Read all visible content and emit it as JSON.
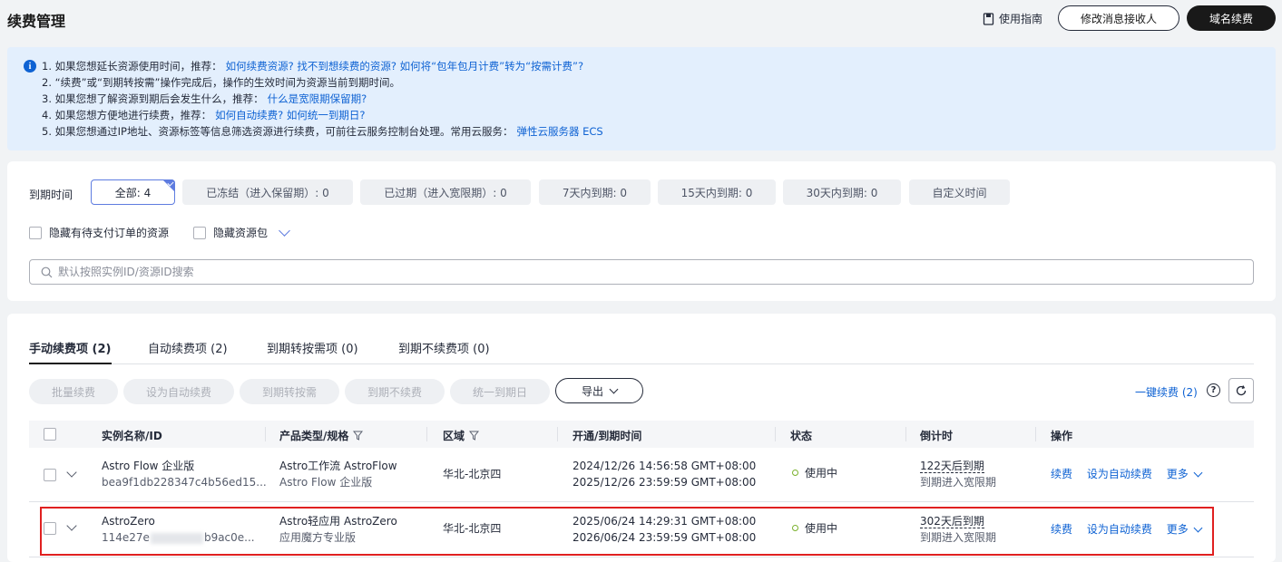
{
  "header": {
    "title": "续费管理",
    "guide_label": "使用指南",
    "modify_receiver_label": "修改消息接收人",
    "domain_renew_label": "域名续费"
  },
  "notice": {
    "lines": [
      {
        "text": "1. 如果您想延长资源使用时间，推荐：",
        "link": "如何续费资源? 找不到想续费的资源? 如何将“包年包月计费”转为“按需计费”?"
      },
      {
        "text": "2. “续费”或“到期转按需”操作完成后，操作的生效时间为资源当前到期时间。",
        "link": ""
      },
      {
        "text": "3. 如果您想了解资源到期后会发生什么，推荐：",
        "link": "什么是宽限期保留期?"
      },
      {
        "text": "4. 如果您想方便地进行续费，推荐：",
        "link": "如何自动续费? 如何统一到期日?"
      },
      {
        "text": "5. 如果您想通过IP地址、资源标签等信息筛选资源进行续费，可前往云服务控制台处理。常用云服务：",
        "link": "弹性云服务器 ECS"
      }
    ]
  },
  "filters": {
    "expire_label": "到期时间",
    "chips": [
      "全部: 4",
      "已冻结（进入保留期）: 0",
      "已过期（进入宽限期）: 0",
      "7天内到期: 0",
      "15天内到期: 0",
      "30天内到期: 0",
      "自定义时间"
    ],
    "hide_pending_label": "隐藏有待支付订单的资源",
    "hide_package_label": "隐藏资源包",
    "search_placeholder": "默认按照实例ID/资源ID搜索"
  },
  "tabs": [
    "手动续费项 (2)",
    "自动续费项 (2)",
    "到期转按需项 (0)",
    "到期不续费项 (0)"
  ],
  "toolbar": {
    "batch_renew": "批量续费",
    "set_auto": "设为自动续费",
    "to_ondemand": "到期转按需",
    "no_renew": "到期不续费",
    "unify_date": "统一到期日",
    "export": "导出",
    "renew_all": "一键续费",
    "renew_all_count": "(2)"
  },
  "table": {
    "columns": [
      "实例名称/ID",
      "产品类型/规格",
      "区域",
      "开通/到期时间",
      "状态",
      "倒计时",
      "操作"
    ],
    "rows": [
      {
        "name": "Astro Flow 企业版",
        "id": "bea9f1db228347c4b56ed15...",
        "product": "Astro工作流 AstroFlow",
        "spec": "Astro Flow 企业版",
        "region": "华北-北京四",
        "open_time": "2024/12/26 14:56:58 GMT+08:00",
        "expire_time": "2025/12/26 23:59:59 GMT+08:00",
        "status": "使用中",
        "countdown": "122天后到期",
        "countdown_sub": "到期进入宽限期",
        "actions": [
          "续费",
          "设为自动续费",
          "更多"
        ]
      },
      {
        "name": "AstroZero",
        "id_prefix": "114e27e",
        "id_suffix": "b9ac0e...",
        "product": "Astro轻应用 AstroZero",
        "spec": "应用魔方专业版",
        "region": "华北-北京四",
        "open_time": "2025/06/24 14:29:31 GMT+08:00",
        "expire_time": "2026/06/24 23:59:59 GMT+08:00",
        "status": "使用中",
        "countdown": "302天后到期",
        "countdown_sub": "到期进入宽限期",
        "actions": [
          "续费",
          "设为自动续费",
          "更多"
        ]
      }
    ]
  },
  "colors": {
    "link": "#0e62d3",
    "notice_bg": "#e3effd",
    "status_ok": "#7ab12d",
    "highlight": "#e02020"
  }
}
